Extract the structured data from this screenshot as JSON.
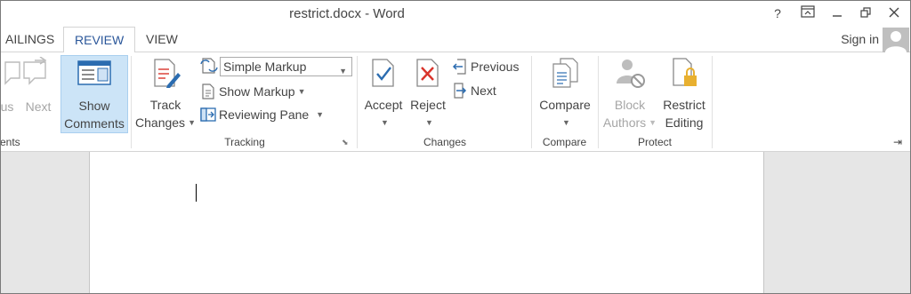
{
  "window": {
    "title": "restrict.docx - Word",
    "help_glyph": "?",
    "ribbon_display_glyph": "⧉",
    "minimize_glyph": "—",
    "restore_glyph": "🗗",
    "close_glyph": "✕"
  },
  "tabs": [
    {
      "label": "AILINGS"
    },
    {
      "label": "REVIEW",
      "active": true
    },
    {
      "label": "VIEW"
    }
  ],
  "account": {
    "sign_in": "Sign in"
  },
  "ribbon": {
    "comments": {
      "group_label": "ents",
      "previous_label": "us",
      "next_label": "Next",
      "show_comments_line1": "Show",
      "show_comments_line2": "Comments"
    },
    "tracking": {
      "group_label": "Tracking",
      "track_changes_line1": "Track",
      "track_changes_line2": "Changes",
      "markup_select_value": "Simple Markup",
      "show_markup": "Show Markup",
      "reviewing_pane": "Reviewing Pane"
    },
    "changes": {
      "group_label": "Changes",
      "accept": "Accept",
      "reject": "Reject",
      "previous": "Previous",
      "next": "Next"
    },
    "compare": {
      "group_label": "Compare",
      "compare": "Compare"
    },
    "protect": {
      "group_label": "Protect",
      "block_authors_line1": "Block",
      "block_authors_line2": "Authors",
      "restrict_editing_line1": "Restrict",
      "restrict_editing_line2": "Editing"
    },
    "collapse_glyph": "⇥",
    "launcher_glyph": "⬊"
  },
  "colors": {
    "accent": "#2b579a",
    "selected_bg": "#cce4f7",
    "reject_red": "#d9342b",
    "accept_blue": "#2b6cb0",
    "lock_gold": "#e8b030"
  }
}
